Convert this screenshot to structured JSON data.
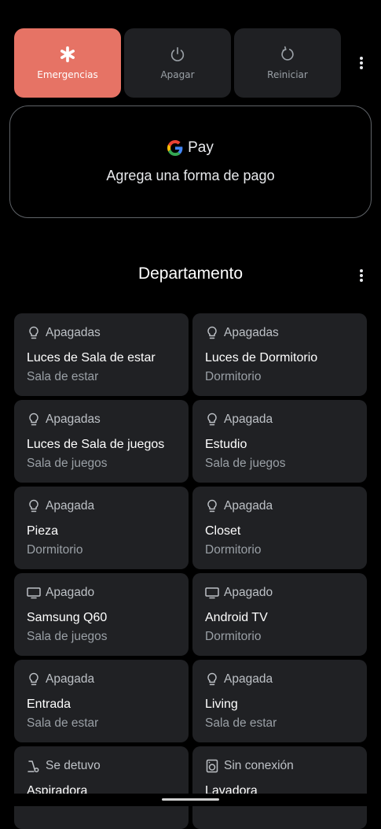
{
  "power_menu": {
    "emergency_label": "Emergencias",
    "power_off_label": "Apagar",
    "restart_label": "Reiniciar"
  },
  "gpay": {
    "brand": "Pay",
    "message": "Agrega una forma de pago"
  },
  "home": {
    "title": "Departamento",
    "tiles": [
      {
        "icon": "lightbulb-icon",
        "status": "Apagadas",
        "name": "Luces de Sala de estar",
        "room": "Sala de estar"
      },
      {
        "icon": "lightbulb-icon",
        "status": "Apagadas",
        "name": "Luces de Dormitorio",
        "room": "Dormitorio"
      },
      {
        "icon": "lightbulb-icon",
        "status": "Apagadas",
        "name": "Luces de Sala de juegos",
        "room": "Sala de juegos"
      },
      {
        "icon": "lightbulb-icon",
        "status": "Apagada",
        "name": "Estudio",
        "room": "Sala de juegos"
      },
      {
        "icon": "lightbulb-icon",
        "status": "Apagada",
        "name": "Pieza",
        "room": "Dormitorio"
      },
      {
        "icon": "lightbulb-icon",
        "status": "Apagada",
        "name": "Closet",
        "room": "Dormitorio"
      },
      {
        "icon": "tv-icon",
        "status": "Apagado",
        "name": "Samsung Q60",
        "room": "Sala de juegos"
      },
      {
        "icon": "tv-icon",
        "status": "Apagado",
        "name": "Android TV",
        "room": "Dormitorio"
      },
      {
        "icon": "lightbulb-icon",
        "status": "Apagada",
        "name": "Entrada",
        "room": "Sala de estar"
      },
      {
        "icon": "lightbulb-icon",
        "status": "Apagada",
        "name": "Living",
        "room": "Sala de estar"
      },
      {
        "icon": "vacuum-icon",
        "status": "Se detuvo",
        "name": "Aspiradora",
        "room": ""
      },
      {
        "icon": "washer-icon",
        "status": "Sin conexión",
        "name": "Lavadora",
        "room": ""
      }
    ]
  },
  "colors": {
    "background": "#000000",
    "tile": "#202124",
    "emergency": "#e67365"
  }
}
